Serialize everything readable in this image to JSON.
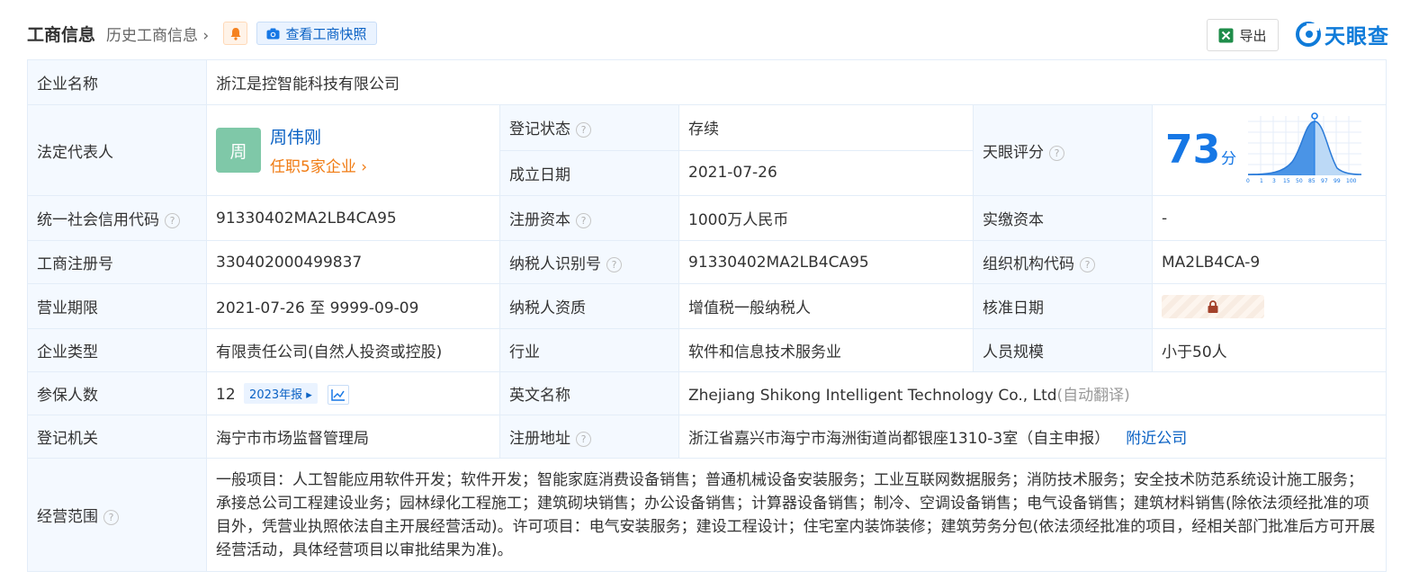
{
  "header": {
    "title": "工商信息",
    "history": "历史工商信息",
    "snapshot": "查看工商快照",
    "export": "导出",
    "logo": "天眼查"
  },
  "rows": {
    "company_name": {
      "label": "企业名称",
      "value": "浙江是控智能科技有限公司"
    },
    "legal_rep": {
      "label": "法定代表人",
      "avatar": "周",
      "name": "周伟刚",
      "link": "任职5家企业"
    },
    "reg_status": {
      "label": "登记状态",
      "value": "存续"
    },
    "found_date": {
      "label": "成立日期",
      "value": "2021-07-26"
    },
    "tianyan_score": {
      "label": "天眼评分",
      "score": "73",
      "unit": "分",
      "axis_ticks": [
        "0",
        "1",
        "3",
        "15",
        "50",
        "85",
        "97",
        "99",
        "100"
      ]
    },
    "credit_code": {
      "label": "统一社会信用代码",
      "value": "91330402MA2LB4CA95"
    },
    "reg_capital": {
      "label": "注册资本",
      "value": "1000万人民币"
    },
    "paid_capital": {
      "label": "实缴资本",
      "value": "-"
    },
    "reg_number": {
      "label": "工商注册号",
      "value": "330402000499837"
    },
    "taxpayer_id": {
      "label": "纳税人识别号",
      "value": "91330402MA2LB4CA95"
    },
    "org_code": {
      "label": "组织机构代码",
      "value": "MA2LB4CA-9"
    },
    "business_term": {
      "label": "营业期限",
      "value": "2021-07-26 至 9999-09-09"
    },
    "taxpayer_qual": {
      "label": "纳税人资质",
      "value": "增值税一般纳税人"
    },
    "approval_date": {
      "label": "核准日期"
    },
    "company_type": {
      "label": "企业类型",
      "value": "有限责任公司(自然人投资或控股)"
    },
    "industry": {
      "label": "行业",
      "value": "软件和信息技术服务业"
    },
    "staff_size": {
      "label": "人员规模",
      "value": "小于50人"
    },
    "insured": {
      "label": "参保人数",
      "value": "12",
      "badge": "2023年报"
    },
    "english_name": {
      "label": "英文名称",
      "value": "Zhejiang Shikong Intelligent Technology Co., Ltd",
      "note": "(自动翻译)"
    },
    "reg_authority": {
      "label": "登记机关",
      "value": "海宁市市场监督管理局"
    },
    "reg_address": {
      "label": "注册地址",
      "value": "浙江省嘉兴市海宁市海洲街道尚都银座1310-3室（自主申报）",
      "link": "附近公司"
    },
    "business_scope": {
      "label": "经营范围",
      "value": "一般项目：人工智能应用软件开发；软件开发；智能家庭消费设备销售；普通机械设备安装服务；工业互联网数据服务；消防技术服务；安全技术防范系统设计施工服务；承接总公司工程建设业务；园林绿化工程施工；建筑砌块销售；办公设备销售；计算器设备销售；制冷、空调设备销售；电气设备销售；建筑材料销售(除依法须经批准的项目外，凭营业执照依法自主开展经营活动)。许可项目：电气安装服务；建设工程设计；住宅室内装饰装修；建筑劳务分包(依法须经批准的项目，经相关部门批准后方可开展经营活动，具体经营项目以审批结果为准)。"
    }
  },
  "colors": {
    "accent": "#1677e5",
    "link": "#0b62c4",
    "orange": "#f07b12",
    "green": "#1fa04a",
    "label_bg": "#f4f9ff"
  }
}
